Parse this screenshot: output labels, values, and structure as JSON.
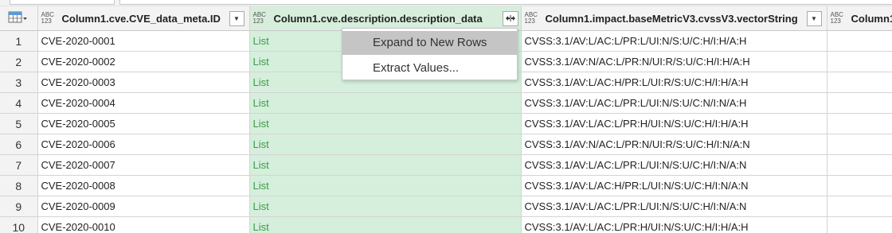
{
  "columns": [
    {
      "type_top": "ABC",
      "type_bottom": "123",
      "title": "Column1.cve.CVE_data_meta.ID"
    },
    {
      "type_top": "ABC",
      "type_bottom": "123",
      "title": "Column1.cve.description.description_data"
    },
    {
      "type_top": "ABC",
      "type_bottom": "123",
      "title": "Column1.impact.baseMetricV3.cvssV3.vectorString"
    },
    {
      "type_top": "ABC",
      "type_bottom": "123",
      "title": "Column1"
    }
  ],
  "rows": [
    {
      "n": "1",
      "id": "CVE-2020-0001",
      "desc": "List",
      "vector": "CVSS:3.1/AV:L/AC:L/PR:L/UI:N/S:U/C:H/I:H/A:H"
    },
    {
      "n": "2",
      "id": "CVE-2020-0002",
      "desc": "List",
      "vector": "CVSS:3.1/AV:N/AC:L/PR:N/UI:R/S:U/C:H/I:H/A:H"
    },
    {
      "n": "3",
      "id": "CVE-2020-0003",
      "desc": "List",
      "vector": "CVSS:3.1/AV:L/AC:H/PR:L/UI:R/S:U/C:H/I:H/A:H"
    },
    {
      "n": "4",
      "id": "CVE-2020-0004",
      "desc": "List",
      "vector": "CVSS:3.1/AV:L/AC:L/PR:L/UI:N/S:U/C:N/I:N/A:H"
    },
    {
      "n": "5",
      "id": "CVE-2020-0005",
      "desc": "List",
      "vector": "CVSS:3.1/AV:L/AC:L/PR:H/UI:N/S:U/C:H/I:H/A:H"
    },
    {
      "n": "6",
      "id": "CVE-2020-0006",
      "desc": "List",
      "vector": "CVSS:3.1/AV:N/AC:L/PR:N/UI:R/S:U/C:H/I:N/A:N"
    },
    {
      "n": "7",
      "id": "CVE-2020-0007",
      "desc": "List",
      "vector": "CVSS:3.1/AV:L/AC:L/PR:L/UI:N/S:U/C:H/I:N/A:N"
    },
    {
      "n": "8",
      "id": "CVE-2020-0008",
      "desc": "List",
      "vector": "CVSS:3.1/AV:L/AC:H/PR:L/UI:N/S:U/C:H/I:N/A:N"
    },
    {
      "n": "9",
      "id": "CVE-2020-0009",
      "desc": "List",
      "vector": "CVSS:3.1/AV:L/AC:L/PR:L/UI:N/S:U/C:H/I:N/A:N"
    },
    {
      "n": "10",
      "id": "CVE-2020-0010",
      "desc": "List",
      "vector": "CVSS:3.1/AV:L/AC:L/PR:H/UI:N/S:U/C:H/I:H/A:H"
    }
  ],
  "expand_menu": {
    "items": [
      "Expand to New Rows",
      "Extract Values..."
    ]
  },
  "icons": {
    "corner": "table-icon",
    "dropdown": "chevron-down-icon",
    "expand": "expand-columns-icon"
  },
  "colors": {
    "selected_column_bg": "#d5efdc",
    "selected_column_text": "#3d9a47",
    "menu_highlight": "#c5c5c5",
    "header_bg": "#f3f3f3"
  }
}
